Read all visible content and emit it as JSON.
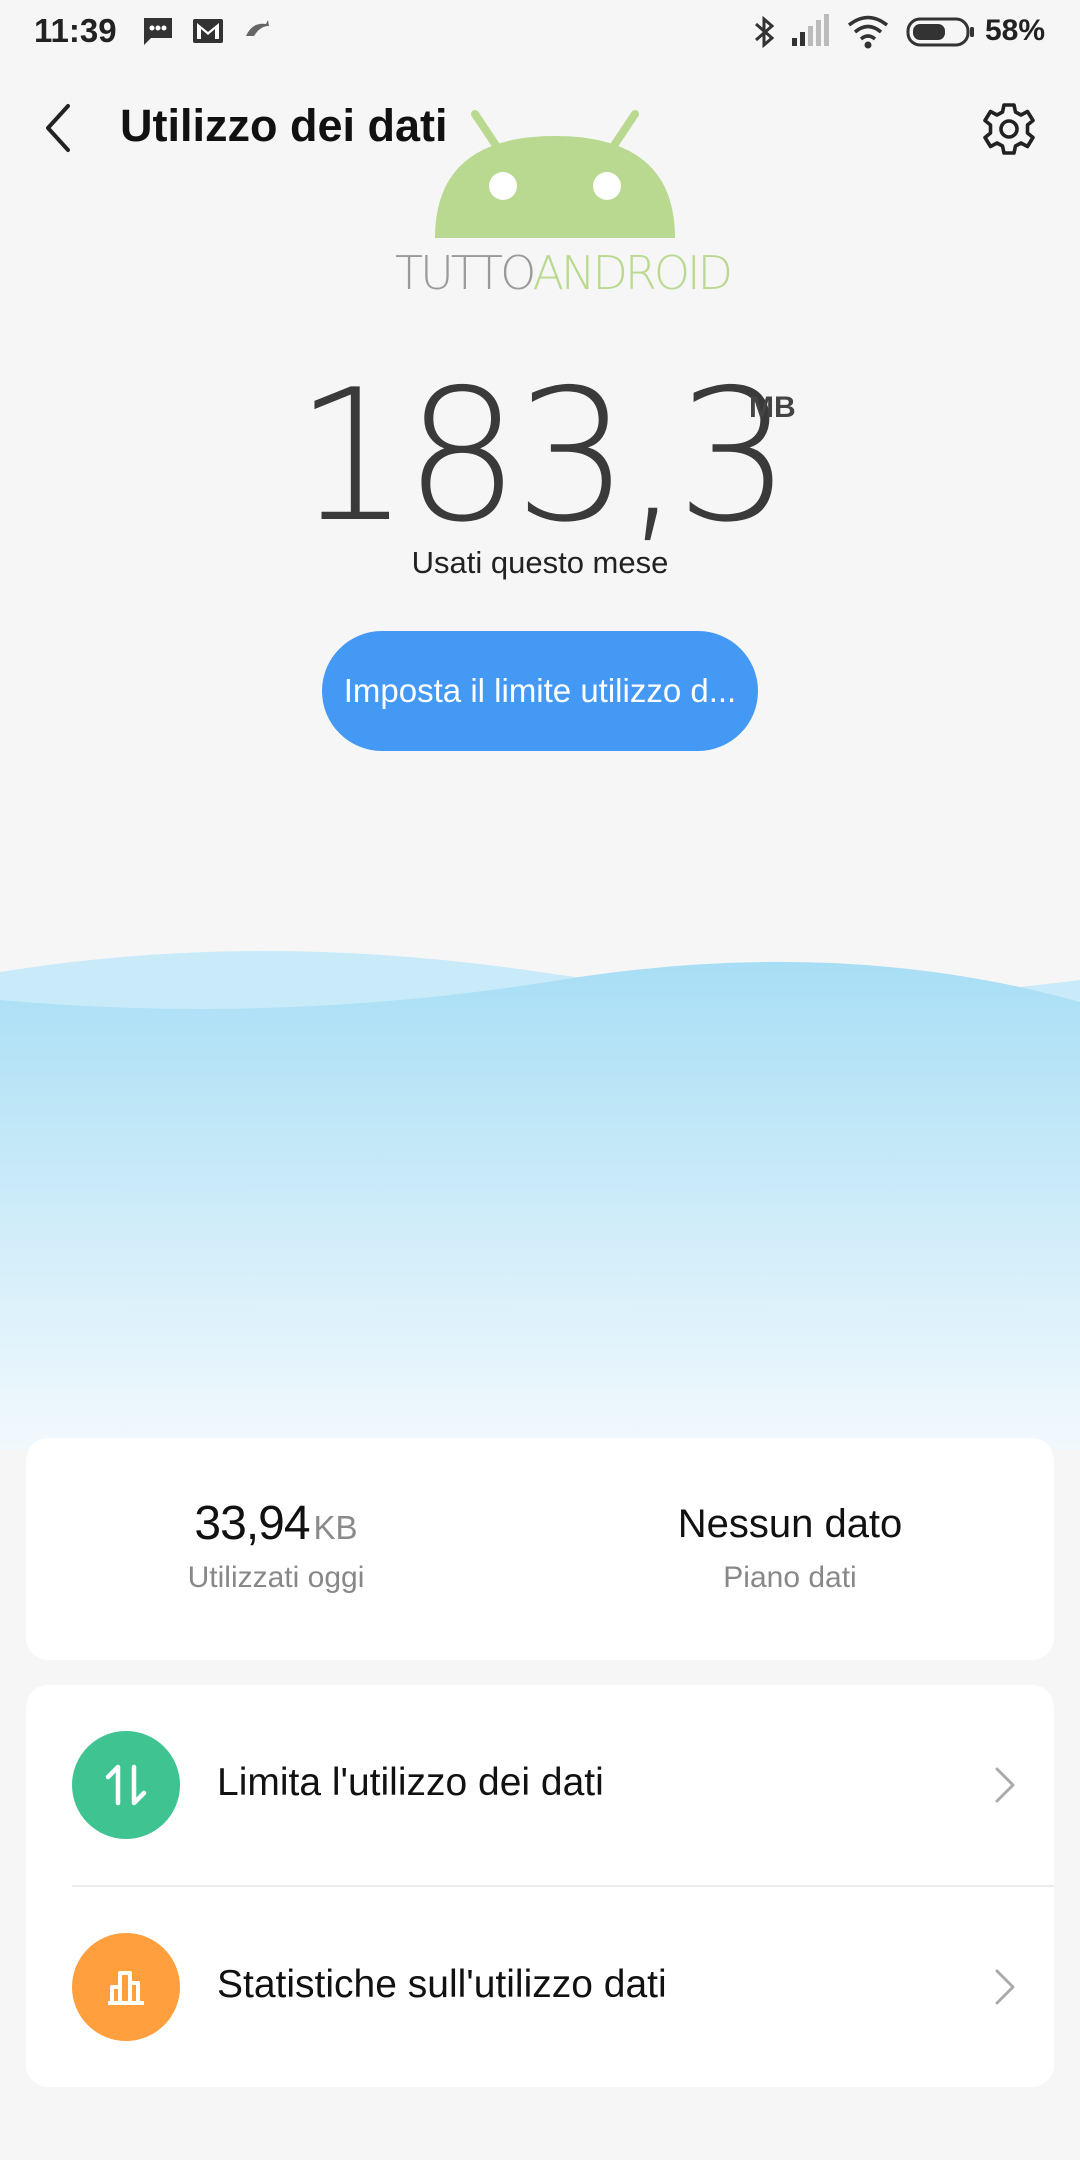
{
  "status_bar": {
    "time": "11:39",
    "battery_percent": "58%",
    "icons": [
      "message-icon",
      "gmail-icon",
      "app-notification-icon",
      "bluetooth-icon",
      "cell-signal-icon",
      "wifi-icon",
      "battery-icon"
    ]
  },
  "header": {
    "title": "Utilizzo dei dati",
    "back_icon": "back-arrow-icon",
    "settings_icon": "gear-icon"
  },
  "watermark": {
    "brand_part1": "TUTTO",
    "brand_part2": "ANDROID",
    "colors": {
      "logo_green": "#b8d98f",
      "text_gray": "#9a9a9a"
    }
  },
  "usage": {
    "value": "183,3",
    "unit": "MB",
    "caption": "Usati questo mese",
    "set_limit_button": "Imposta il limite utilizzo d..."
  },
  "summary": {
    "today_value": "33,94",
    "today_unit": "KB",
    "today_label": "Utilizzati oggi",
    "plan_value": "Nessun dato",
    "plan_label": "Piano dati"
  },
  "menu": {
    "items": [
      {
        "label": "Limita l'utilizzo dei dati",
        "icon": "up-down-arrows-icon",
        "color": "#3fc491"
      },
      {
        "label": "Statistiche sull'utilizzo dati",
        "icon": "bar-chart-icon",
        "color": "#ff9f3e"
      }
    ]
  },
  "colors": {
    "accent_blue": "#4399f4",
    "wave_top": "#a8def5",
    "wave_bottom": "#e9f6fc",
    "background": "#f6f6f6"
  }
}
